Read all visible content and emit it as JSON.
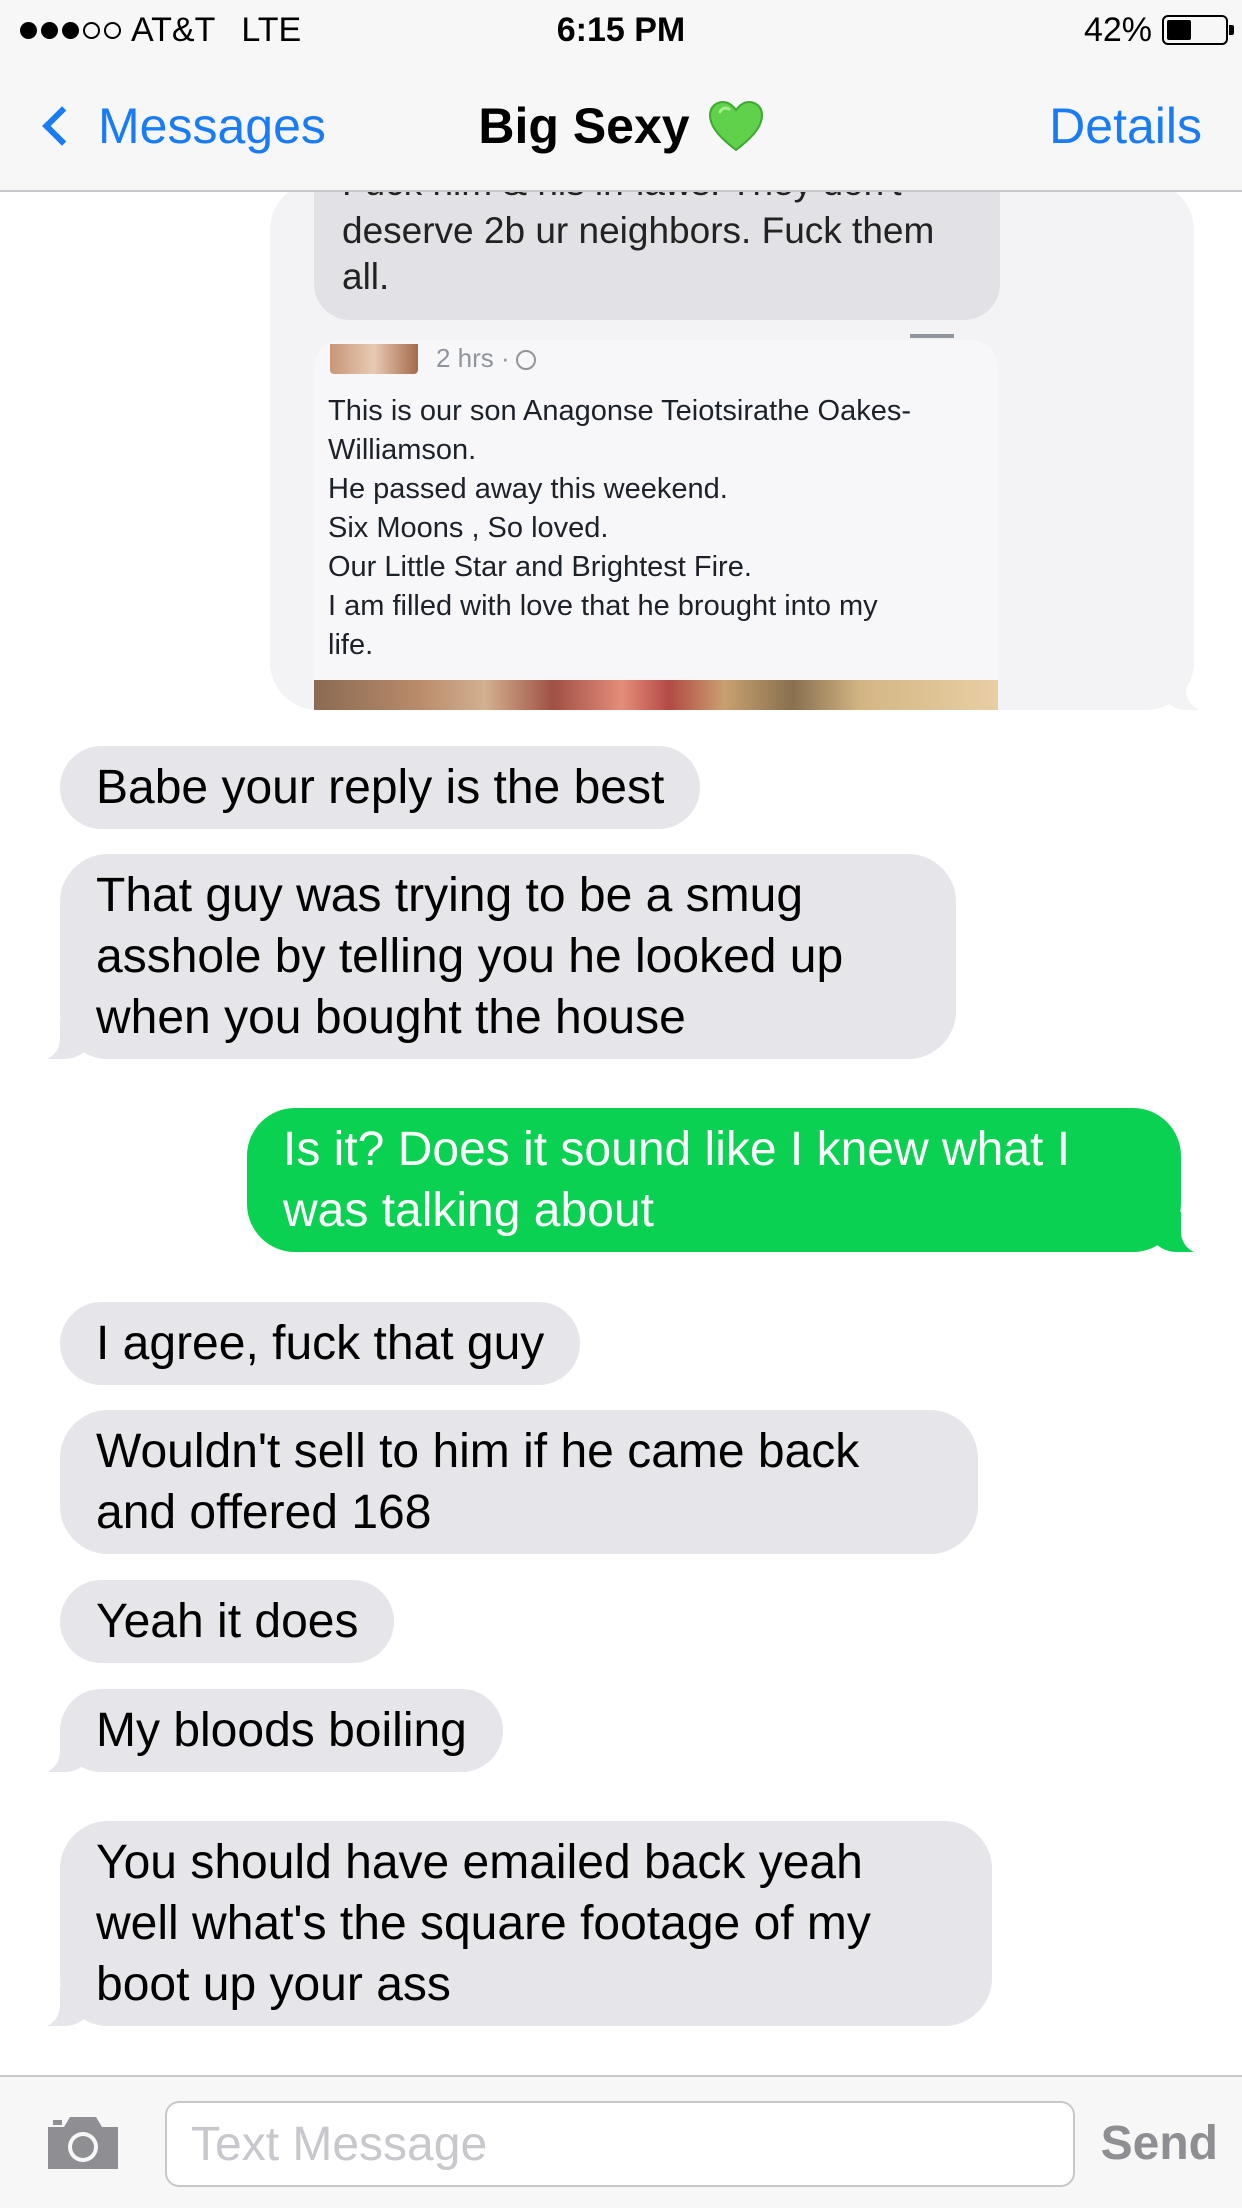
{
  "status_bar": {
    "carrier": "AT&T",
    "network": "LTE",
    "time": "6:15 PM",
    "battery_percent": "42%",
    "battery_level": 0.42,
    "signal_bars_filled": 3,
    "signal_bars_total": 5
  },
  "nav": {
    "back_label": "Messages",
    "title": "Big Sexy",
    "title_emoji": "green-heart-icon",
    "details_label": "Details"
  },
  "shared_image": {
    "reply_lines": [
      "Fuck him & his in-laws. They don't",
      "deserve 2b ur neighbors. Fuck them",
      "all."
    ],
    "post_meta": "2 hrs ·",
    "post_lines": [
      "This is our son Anagonse Teiotsirathe Oakes-",
      "Williamson.",
      "He passed away this weekend.",
      "Six Moons , So loved.",
      "Our Little Star and Brightest Fire.",
      "I am filled with love that he brought into my",
      "life."
    ]
  },
  "messages": [
    {
      "from": "them",
      "text": "Babe your reply is the best"
    },
    {
      "from": "them",
      "text": "That guy was trying to be a smug asshole by telling you he looked up when you bought the house"
    },
    {
      "from": "me",
      "text": "Is it? Does it sound like I knew what I was talking about"
    },
    {
      "from": "them",
      "text": "I agree, fuck that guy"
    },
    {
      "from": "them",
      "text": "Wouldn't sell to him if he came back and offered 168"
    },
    {
      "from": "them",
      "text": "Yeah it does"
    },
    {
      "from": "them",
      "text": "My bloods boiling"
    },
    {
      "from": "them",
      "text": "You should have emailed back yeah well what's the square footage of my boot up your ass"
    }
  ],
  "composer": {
    "placeholder": "Text Message",
    "send_label": "Send"
  },
  "colors": {
    "accent_blue": "#1a7cf5",
    "sent_bubble": "#0bd152",
    "received_bubble": "#e5e5ea",
    "heart": "#5fd14a"
  }
}
